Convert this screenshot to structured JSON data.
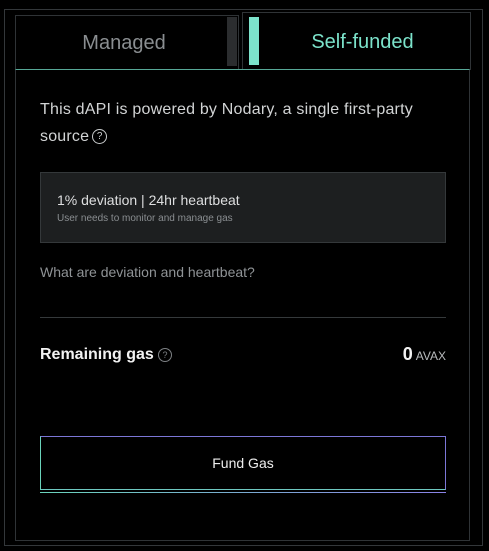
{
  "tabs": {
    "managed_label": "Managed",
    "self_funded_label": "Self-funded"
  },
  "description": {
    "text": "This dAPI is powered by Nodary, a single first-party source",
    "help_glyph": "?"
  },
  "info_box": {
    "primary": "1% deviation | 24hr heartbeat",
    "secondary": "User needs to monitor and manage gas"
  },
  "help_link": "What are deviation and heartbeat?",
  "gas": {
    "label": "Remaining gas",
    "help_glyph": "?",
    "value": "0",
    "unit": "AVAX"
  },
  "fund_button_label": "Fund Gas",
  "colors": {
    "accent": "#7ce3cb",
    "button_border_purple": "#7b76d6"
  }
}
